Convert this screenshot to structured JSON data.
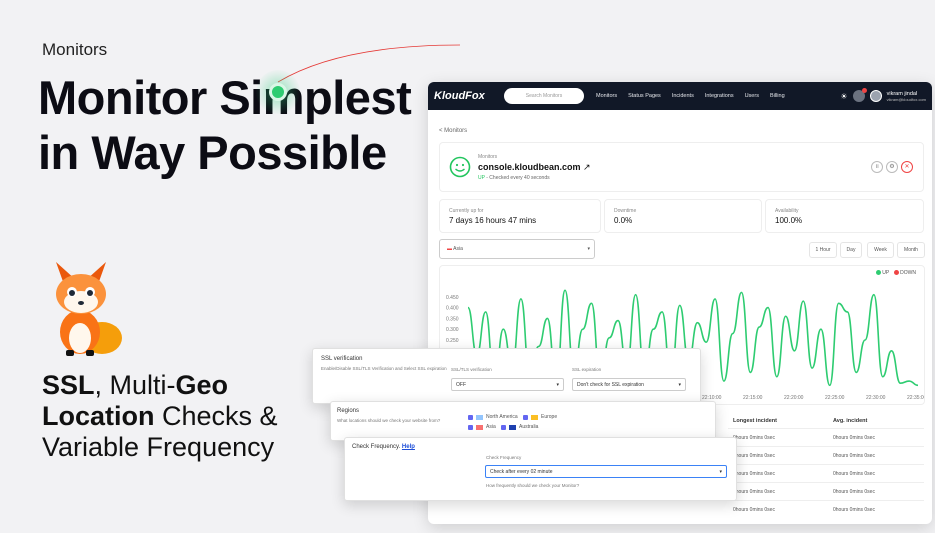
{
  "hero": {
    "kicker": "Monitors",
    "headline": "Monitor Simplest in Way Possible",
    "tagline_ssl": "SSL",
    "tagline_part1": ", Multi-",
    "tagline_geo": "Geo",
    "tagline_location": "Location",
    "tagline_part2": " Checks & Variable Frequency",
    "accent_color": "#2ecc71"
  },
  "nav": {
    "logo": "KloudFox",
    "search_placeholder": "Search Monitors",
    "links": [
      "Monitors",
      "Status Pages",
      "Incidents",
      "Integrations",
      "Users",
      "Billing"
    ],
    "user_name": "vikram jindal",
    "user_email": "vikram@kloudfox.com"
  },
  "monitor": {
    "back_label": "< Monitors",
    "label": "Monitors",
    "name": "console.kloudbean.com",
    "status_up": "UP",
    "status_text": " - Checked every 40 seconds",
    "stats": [
      {
        "label": "Currently up for",
        "value": "7 days 16 hours 47 mins"
      },
      {
        "label": "Downtime",
        "value": "0.0%"
      },
      {
        "label": "Availability",
        "value": "100.0%"
      }
    ],
    "region": "Asia",
    "ranges": [
      "1 Hour",
      "Day",
      "Week",
      "Month"
    ]
  },
  "chart_data": {
    "type": "line",
    "series": [
      {
        "name": "UP",
        "values": [
          0.4,
          0.18,
          0.38,
          0.05,
          0.3,
          0.12,
          0.44,
          0.08,
          0.22,
          0.35,
          0.05,
          0.48,
          0.1,
          0.3,
          0.42,
          0.06,
          0.26,
          0.34,
          0.12,
          0.46,
          0.09,
          0.3,
          0.38,
          0.07,
          0.41,
          0.15,
          0.33,
          0.24,
          0.44,
          0.06,
          0.28,
          0.47,
          0.1,
          0.31,
          0.4,
          0.08,
          0.36,
          0.2,
          0.43,
          0.12,
          0.3,
          0.04,
          0.42,
          0.38,
          0.1,
          0.25,
          0.46,
          0.08,
          0.2,
          0.05,
          0.06,
          0.04
        ]
      }
    ],
    "legend": [
      "UP",
      "DOWN"
    ],
    "legend_colors": [
      "#2ecc71",
      "#ef4444"
    ],
    "yticks": [
      "0.450",
      "0.400",
      "0.350",
      "0.300",
      "0.250"
    ],
    "xticks": [
      "22:10:00",
      "22:15:00",
      "22:20:00",
      "22:25:00",
      "22:30:00",
      "22:35:00"
    ],
    "ylim": [
      0,
      0.5
    ]
  },
  "table": {
    "headers": [
      "Longest incident",
      "Avg. incident"
    ],
    "rows": [
      [
        "0hours 0mins 0sec",
        "0hours 0mins 0sec"
      ],
      [
        "0hours 0mins 0sec",
        "0hours 0mins 0sec"
      ],
      [
        "0hours 0mins 0sec",
        "0hours 0mins 0sec"
      ],
      [
        "0hours 0mins 0sec",
        "0hours 0mins 0sec"
      ],
      [
        "0hours 0mins 0sec",
        "0hours 0mins 0sec"
      ]
    ]
  },
  "ssl": {
    "title": "SSL verification",
    "description": "Enable/Disable SSL/TLS Verification and Select SSL expiration",
    "verify_label": "SSL/TLS verification",
    "verify_value": "OFF",
    "expiry_label": "SSL expiration",
    "expiry_value": "Don't check for SSL expiration"
  },
  "regions": {
    "title": "Regions",
    "description": "What locations should we check your website from?",
    "options": [
      "North America",
      "Europe",
      "Asia",
      "Australia"
    ]
  },
  "frequency": {
    "title": "Check Frequency. ",
    "help": "Help",
    "label": "Check Frequency",
    "value": "Check after every 02 minute",
    "hint": "How frequently should we check your Monitor?"
  }
}
